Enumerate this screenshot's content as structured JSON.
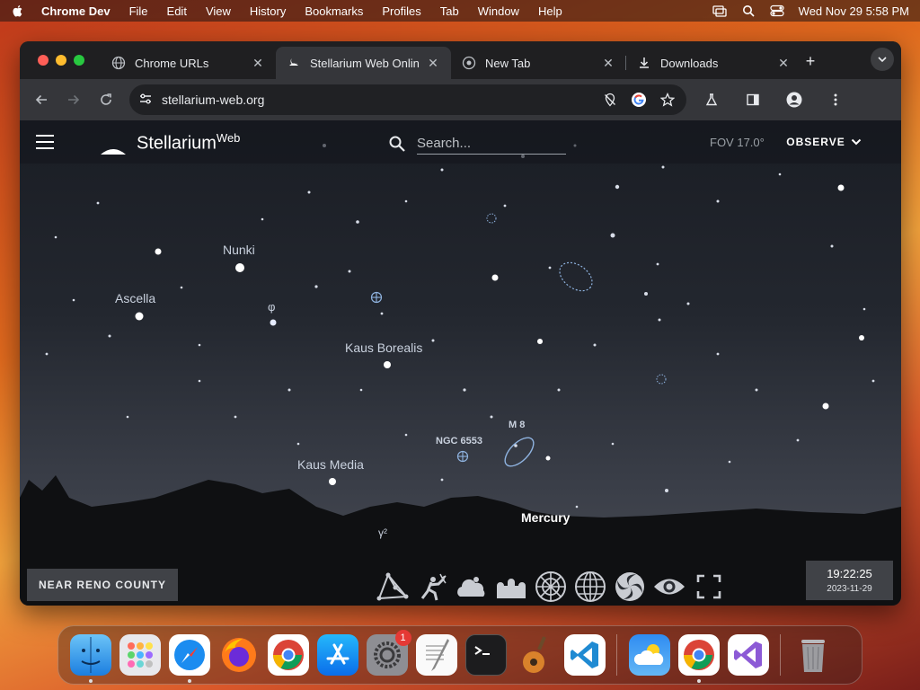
{
  "menubar": {
    "app_name": "Chrome Dev",
    "items": [
      "File",
      "Edit",
      "View",
      "History",
      "Bookmarks",
      "Profiles",
      "Tab",
      "Window",
      "Help"
    ],
    "datetime": "Wed Nov 29  5:58 PM"
  },
  "browser": {
    "tabs": [
      {
        "title": "Chrome URLs",
        "icon": "globe-icon",
        "active": false
      },
      {
        "title": "Stellarium Web Onlin",
        "icon": "stellarium-icon",
        "active": true
      },
      {
        "title": "New Tab",
        "icon": "chrome-icon",
        "active": false
      },
      {
        "title": "Downloads",
        "icon": "download-icon",
        "active": false
      }
    ],
    "url": "stellarium-web.org"
  },
  "stellarium": {
    "brand": "Stellarium",
    "brand_sup": "Web",
    "search_placeholder": "Search...",
    "fov": "FOV 17.0°",
    "observe_label": "OBSERVE",
    "location": "NEAR RENO COUNTY",
    "time": "19:22:25",
    "date": "2023-11-29",
    "labels": {
      "nunki": "Nunki",
      "ascella": "Ascella",
      "phi": "φ",
      "kaus_borealis": "Kaus Borealis",
      "m8": "M 8",
      "ngc6553": "NGC 6553",
      "kaus_media": "Kaus Media",
      "mercury": "Mercury",
      "gamma2": "γ²"
    },
    "toolbar": [
      "constellation-lines-icon",
      "constellation-art-icon",
      "atmosphere-icon",
      "landscape-icon",
      "azimuthal-grid-icon",
      "equatorial-grid-icon",
      "deep-sky-objects-icon",
      "night-mode-icon",
      "fullscreen-icon"
    ]
  },
  "dock": {
    "apps": [
      "Finder",
      "Launchpad",
      "Safari",
      "Firefox",
      "Chrome",
      "App Store",
      "System Settings",
      "TextEdit",
      "Terminal",
      "GarageBand",
      "VS Code",
      "Weather",
      "Chrome Dev",
      "Visual Studio",
      "Trash"
    ],
    "settings_badge": "1"
  },
  "colors": {
    "sky_top": "#1a1d24",
    "sky_bottom": "#4a4d55",
    "label": "#c9d1de"
  }
}
